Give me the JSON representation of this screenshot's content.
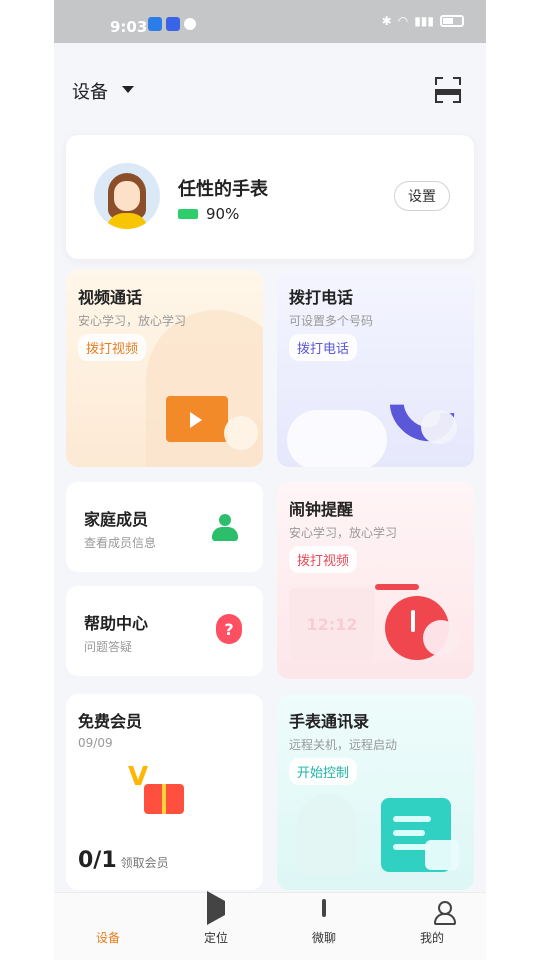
{
  "status_bar": {
    "time": "9:03"
  },
  "header": {
    "device_label": "设备"
  },
  "profile": {
    "name": "任性的手表",
    "battery_percent": "90%",
    "settings_button": "设置"
  },
  "cards": {
    "video_call": {
      "title": "视频通话",
      "subtitle": "安心学习，放心学习",
      "action": "拨打视频"
    },
    "phone_call": {
      "title": "拨打电话",
      "subtitle": "可设置多个号码",
      "action": "拨打电话"
    },
    "family": {
      "title": "家庭成员",
      "subtitle": "查看成员信息"
    },
    "help": {
      "title": "帮助中心",
      "subtitle": "问题答疑"
    },
    "alarm": {
      "title": "闹钟提醒",
      "subtitle": "安心学习，放心学习",
      "action": "拨打视频",
      "clock_text": "12:12"
    },
    "vip": {
      "title": "免费会员",
      "subtitle": "09/09",
      "count": "0/1",
      "count_label": "领取会员"
    },
    "contacts": {
      "title": "手表通讯录",
      "subtitle": "远程关机，远程启动",
      "action": "开始控制"
    }
  },
  "tabbar": {
    "items": [
      {
        "label": "设备",
        "icon": "watch-icon"
      },
      {
        "label": "定位",
        "icon": "location-icon"
      },
      {
        "label": "微聊",
        "icon": "chat-icon"
      },
      {
        "label": "我的",
        "icon": "user-icon"
      }
    ]
  },
  "colors": {
    "accent": "#e67e22",
    "battery": "#2ecf6b"
  }
}
